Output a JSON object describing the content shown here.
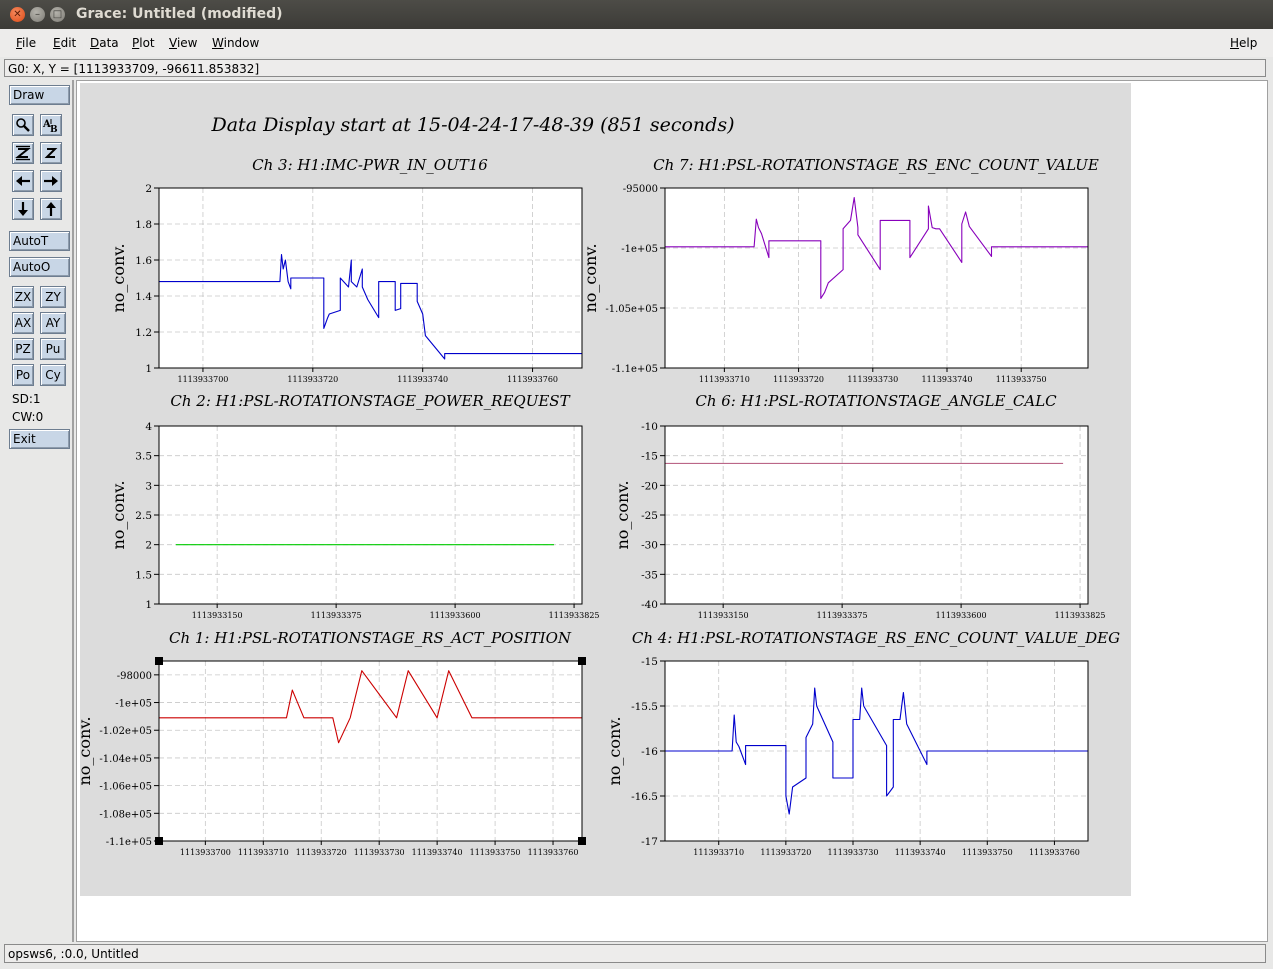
{
  "window": {
    "title": "Grace: Untitled (modified)"
  },
  "menubar": {
    "items": [
      {
        "label": "File",
        "key": "F",
        "rest": "ile"
      },
      {
        "label": "Edit",
        "key": "E",
        "rest": "dit"
      },
      {
        "label": "Data",
        "key": "D",
        "rest": "ata"
      },
      {
        "label": "Plot",
        "key": "P",
        "rest": "lot"
      },
      {
        "label": "View",
        "key": "V",
        "rest": "iew"
      },
      {
        "label": "Window",
        "key": "W",
        "rest": "indow"
      },
      {
        "label": "Help",
        "key": "H",
        "rest": "elp"
      }
    ]
  },
  "locator": "G0: X, Y = [1113933709, -96611.853832]",
  "toolbar": {
    "draw": "Draw",
    "autot": "AutoT",
    "autoo": "AutoO",
    "zx": "ZX",
    "zy": "ZY",
    "ax": "AX",
    "ay": "AY",
    "pz": "PZ",
    "pu": "Pu",
    "po": "Po",
    "cy": "Cy",
    "sd": "SD:1",
    "cw": "CW:0",
    "exit": "Exit",
    "icons": [
      "zoom-icon",
      "text-icon",
      "autoscale-z-icon",
      "z-icon",
      "arrow-left-icon",
      "arrow-right-icon",
      "arrow-down-icon",
      "arrow-up-icon"
    ]
  },
  "status": "opsws6, :0.0, Untitled",
  "page_title": "Data Display start at 15-04-24-17-48-39 (851 seconds)",
  "chart_data": [
    {
      "type": "line",
      "title": "Ch 3: H1:IMC-PWR_IN_OUT16",
      "ylabel": "no_conv.",
      "color": "#0000cc",
      "ylim": [
        1,
        2
      ],
      "xlim": [
        1113933692,
        1113933769
      ],
      "yticks": [
        "2",
        "1.8",
        "1.6",
        "1.4",
        "1.2",
        "1"
      ],
      "xticks": [
        "1113933700",
        "1113933720",
        "1113933740",
        "1113933760"
      ],
      "x": [
        1113933692,
        1113933714,
        1113933714.3,
        1113933714.6,
        1113933715,
        1113933715.5,
        1113933716,
        1113933716,
        1113933722,
        1113933722,
        1113933722.7,
        1113933723,
        1113933725,
        1113933725,
        1113933726.5,
        1113933727,
        1113933727,
        1113933728,
        1113933729,
        1113933729,
        1113933730,
        1113933732,
        1113933732,
        1113933735,
        1113933735,
        1113933736,
        1113933736,
        1113933739,
        1113933739,
        1113933740,
        1113933740.5,
        1113933744,
        1113933744,
        1113933769
      ],
      "y": [
        1.48,
        1.48,
        1.63,
        1.55,
        1.6,
        1.48,
        1.44,
        1.5,
        1.5,
        1.22,
        1.28,
        1.3,
        1.32,
        1.5,
        1.45,
        1.6,
        1.48,
        1.45,
        1.55,
        1.45,
        1.38,
        1.28,
        1.48,
        1.48,
        1.32,
        1.33,
        1.47,
        1.47,
        1.37,
        1.3,
        1.18,
        1.05,
        1.08,
        1.08
      ]
    },
    {
      "type": "line",
      "title": "Ch 7: H1:PSL-ROTATIONSTAGE_RS_ENC_COUNT_VALUE",
      "ylabel": "no_conv.",
      "color": "#8800bb",
      "ylim": [
        -110000,
        -95000
      ],
      "xlim": [
        1113933702,
        1113933759
      ],
      "yticks": [
        "-95000",
        "-1e+05",
        "-1.05e+05",
        "-1.1e+05"
      ],
      "xticks": [
        "1113933710",
        "1113933720",
        "1113933730",
        "1113933740",
        "1113933750"
      ],
      "x": [
        1113933702,
        1113933714,
        1113933714.3,
        1113933714.6,
        1113933715,
        1113933716,
        1113933716,
        1113933723,
        1113933723,
        1113933723.5,
        1113933724,
        1113933726,
        1113933726,
        1113933727,
        1113933727.5,
        1113933728,
        1113933728,
        1113933731,
        1113933731,
        1113933735,
        1113933735,
        1113933737.5,
        1113933737.5,
        1113933738,
        1113933738.5,
        1113933739,
        1113933742,
        1113933742,
        1113933742.5,
        1113933743,
        1113933746,
        1113933746,
        1113933759
      ],
      "y": [
        -99900,
        -99900,
        -97600,
        -98300,
        -98800,
        -100800,
        -99400,
        -99400,
        -104200,
        -103700,
        -102900,
        -101800,
        -98400,
        -97700,
        -95800,
        -98300,
        -98900,
        -101800,
        -97700,
        -97700,
        -100800,
        -98400,
        -96500,
        -98300,
        -98400,
        -98400,
        -101200,
        -98000,
        -97000,
        -98200,
        -100700,
        -99900,
        -99900
      ]
    },
    {
      "type": "line",
      "title": "Ch 2: H1:PSL-ROTATIONSTAGE_POWER_REQUEST",
      "ylabel": "no_conv.",
      "color": "#00cc00",
      "ylim": [
        1,
        4
      ],
      "xlim": [
        1113933040,
        1113933840
      ],
      "yticks": [
        "4",
        "3.5",
        "3",
        "2.5",
        "2",
        "1.5",
        "1"
      ],
      "xticks": [
        "1113933150",
        "1113933375",
        "1113933600",
        "1113933825"
      ],
      "x": [
        1113933072,
        1113933787
      ],
      "y": [
        2,
        2
      ]
    },
    {
      "type": "line",
      "title": "Ch 6: H1:PSL-ROTATIONSTAGE_ANGLE_CALC",
      "ylabel": "no_conv.",
      "color": "#bb6688",
      "ylim": [
        -40,
        -10
      ],
      "xlim": [
        1113933040,
        1113933840
      ],
      "yticks": [
        "-10",
        "-15",
        "-20",
        "-25",
        "-30",
        "-35",
        "-40"
      ],
      "xticks": [
        "1113933150",
        "1113933375",
        "1113933600",
        "1113933825"
      ],
      "x": [
        1113933040,
        1113933793
      ],
      "y": [
        -16.3,
        -16.3
      ]
    },
    {
      "type": "line",
      "title": "Ch 1: H1:PSL-ROTATIONSTAGE_RS_ACT_POSITION",
      "ylabel": "no_conv.",
      "color": "#cc0000",
      "ylim": [
        -110000,
        -97000
      ],
      "xlim": [
        1113933692,
        1113933765
      ],
      "yticks": [
        "-98000",
        "-1e+05",
        "-1.02e+05",
        "-1.04e+05",
        "-1.06e+05",
        "-1.08e+05",
        "-1.1e+05"
      ],
      "xticks": [
        "1113933700",
        "1113933710",
        "1113933720",
        "1113933730",
        "1113933740",
        "1113933750",
        "1113933760"
      ],
      "x": [
        1113933692,
        1113933714,
        1113933715,
        1113933717,
        1113933722,
        1113933723,
        1113933725,
        1113933725,
        1113933727,
        1113933733,
        1113933733,
        1113933735,
        1113933740,
        1113933740,
        1113933742,
        1113933746,
        1113933765
      ],
      "y": [
        -101100,
        -101100,
        -99100,
        -101100,
        -101100,
        -102900,
        -101100,
        -101100,
        -97700,
        -101100,
        -101100,
        -97700,
        -101100,
        -101100,
        -97700,
        -101100,
        -101100
      ]
    },
    {
      "type": "line",
      "title": "Ch 4: H1:PSL-ROTATIONSTAGE_RS_ENC_COUNT_VALUE_DEG",
      "ylabel": "no_conv.",
      "color": "#0000cc",
      "ylim": [
        -17,
        -15
      ],
      "xlim": [
        1113933702,
        1113933765
      ],
      "yticks": [
        "-15",
        "-15.5",
        "-16",
        "-16.5",
        "-17"
      ],
      "xticks": [
        "1113933710",
        "1113933720",
        "1113933730",
        "1113933740",
        "1113933750",
        "1113933760"
      ],
      "x": [
        1113933702,
        1113933712,
        1113933712.3,
        1113933712.6,
        1113933713,
        1113933714,
        1113933714,
        1113933720,
        1113933720,
        1113933720.5,
        1113933721,
        1113933723,
        1113933723,
        1113933724,
        1113933724.3,
        1113933724.6,
        1113933727,
        1113933727,
        1113933730,
        1113933730,
        1113933731,
        1113933731.3,
        1113933731.6,
        1113933735,
        1113933735,
        1113933736,
        1113933736,
        1113933737,
        1113933737.5,
        1113933738,
        1113933741,
        1113933741,
        1113933765
      ],
      "y": [
        -16,
        -16,
        -15.6,
        -15.9,
        -15.95,
        -16.15,
        -15.94,
        -15.94,
        -16.5,
        -16.7,
        -16.4,
        -16.3,
        -15.85,
        -15.7,
        -15.3,
        -15.5,
        -15.9,
        -16.3,
        -16.3,
        -15.65,
        -15.65,
        -15.3,
        -15.5,
        -15.94,
        -16.5,
        -16.4,
        -15.65,
        -15.65,
        -15.35,
        -15.7,
        -16.15,
        -16,
        -16
      ]
    }
  ]
}
